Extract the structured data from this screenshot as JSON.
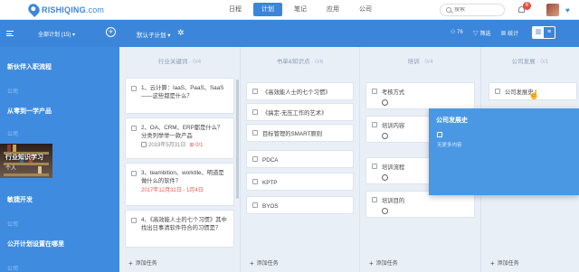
{
  "brand": {
    "name": "RISHIQING",
    "suffix": ".com",
    "color": "#3b86da"
  },
  "topnav": [
    {
      "label": "日程",
      "active": false
    },
    {
      "label": "计划",
      "active": true
    },
    {
      "label": "笔记",
      "active": false
    },
    {
      "label": "应用",
      "active": false
    },
    {
      "label": "公司",
      "active": false
    }
  ],
  "search": {
    "placeholder": "搜索"
  },
  "notifications": {
    "count": "6"
  },
  "subbar": {
    "all_plans": "全部计划 (15)",
    "plan_name": "默认子计划",
    "tools": [
      "76",
      "筛选",
      "统计"
    ]
  },
  "sidebar": {
    "items": [
      {
        "label": "新伙伴入职流程",
        "type": "title"
      },
      {
        "label": "公司",
        "type": "sub"
      },
      {
        "label": "从零到一学产品",
        "type": "title"
      },
      {
        "label": "公司",
        "type": "sub"
      },
      {
        "label": "行业知识学习",
        "type": "photo",
        "sub": "个人"
      },
      {
        "label": "敏捷开发",
        "type": "title"
      },
      {
        "label": "公司",
        "type": "sub"
      },
      {
        "label": "公开计划设置在哪里",
        "type": "title"
      },
      {
        "label": "公司",
        "type": "sub"
      }
    ]
  },
  "columns": [
    {
      "title": "行业关键词",
      "count": "· 0/4",
      "cards": [
        {
          "text": "1、云计算：IaaS、PaaS、SaaS——这些都是什么？"
        },
        {
          "text": "2、OA、CRM、ERP都是什么？分类列举举一款产品",
          "date": "2019年5月31日",
          "sub": "0/1"
        },
        {
          "text": "3、teambition、worktile、明道是做什么的软件？",
          "date_range": "2017年12月31日 - 1月4日"
        },
        {
          "text": "4、《高效能人士的七个习惯》其中找出日事清软件符合的习惯是？"
        }
      ],
      "add_label": "添加任务"
    },
    {
      "title": "书单&知识点",
      "count": "· 0/6",
      "cards": [
        {
          "text": "《高效能人士的七个习惯》"
        },
        {
          "text": "《搞定-无压工作的艺术》"
        },
        {
          "text": "目标管理的SMART原则"
        },
        {
          "text": "PDCA"
        },
        {
          "text": "KPTP"
        },
        {
          "text": "BYOS"
        }
      ],
      "add_label": "添加任务"
    },
    {
      "title": "培训",
      "count": "· 0/4",
      "cards": [
        {
          "text": "考核方式"
        },
        {
          "text": "培训内容"
        },
        {
          "text": "培训流程"
        },
        {
          "text": "培训目的"
        }
      ],
      "add_label": "添加任务"
    },
    {
      "title": "公司发展",
      "count": "· 0/1",
      "cards": [
        {
          "text": "公司发展史"
        }
      ],
      "add_label": "添加任务"
    }
  ],
  "popup": {
    "title": "公司发展史",
    "desc": "无更多内容"
  }
}
